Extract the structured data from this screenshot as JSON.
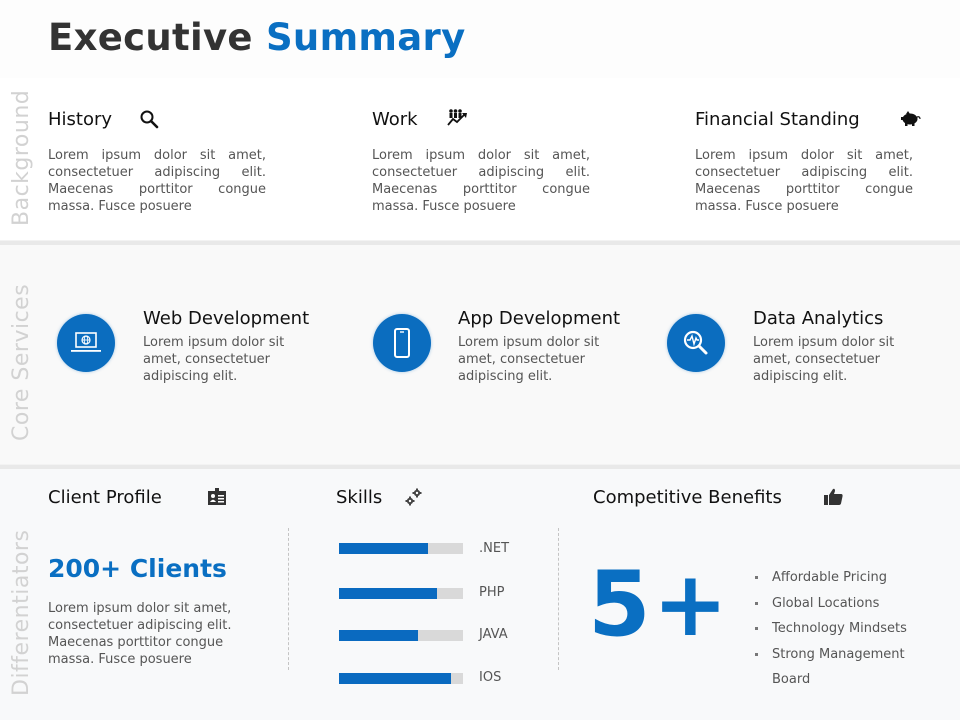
{
  "title": {
    "part1": "Executive",
    "part2": "Summary"
  },
  "colors": {
    "accent": "#0a6fc2",
    "title_dark": "#333333",
    "side_label": "#d2d2d2",
    "bar_track": "#d9d9d9"
  },
  "sections": {
    "background": {
      "label": "Background",
      "items": [
        {
          "title": "History",
          "icon": "magnifier-icon",
          "text": "Lorem ipsum dolor sit amet, consectetuer adipiscing elit. Maecenas porttitor congue massa. Fusce posuere"
        },
        {
          "title": "Work",
          "icon": "team-growth-icon",
          "text": "Lorem ipsum dolor sit amet, consectetuer adipiscing elit. Maecenas porttitor congue massa. Fusce posuere"
        },
        {
          "title": "Financial Standing",
          "icon": "piggy-bank-icon",
          "text": "Lorem ipsum dolor sit amet, consectetuer adipiscing elit. Maecenas porttitor congue massa. Fusce posuere"
        }
      ]
    },
    "core_services": {
      "label": "Core Services",
      "items": [
        {
          "title": "Web Development",
          "icon": "laptop-globe-icon",
          "text": "Lorem ipsum dolor sit amet, consectetuer adipiscing elit."
        },
        {
          "title": "App Development",
          "icon": "smartphone-icon",
          "text": "Lorem ipsum dolor sit amet, consectetuer adipiscing elit."
        },
        {
          "title": "Data Analytics",
          "icon": "analytics-magnifier-icon",
          "text": "Lorem ipsum dolor sit amet, consectetuer adipiscing elit."
        }
      ]
    },
    "differentiators": {
      "label": "Differentiators",
      "client_profile": {
        "title": "Client Profile",
        "icon": "id-card-icon",
        "headline": "200+ Clients",
        "text": "Lorem ipsum dolor sit amet, consectetuer adipiscing elit. Maecenas porttitor congue massa. Fusce posuere"
      },
      "skills": {
        "title": "Skills",
        "icon": "gears-icon",
        "items": [
          {
            "label": ".NET",
            "percent": 72
          },
          {
            "label": "PHP",
            "percent": 79
          },
          {
            "label": "JAVA",
            "percent": 64
          },
          {
            "label": "IOS",
            "percent": 90
          }
        ]
      },
      "competitive_benefits": {
        "title": "Competitive Benefits",
        "icon": "thumbs-up-icon",
        "big_number": "5+",
        "bullets": [
          "Affordable Pricing",
          "Global Locations",
          "Technology Mindsets",
          "Strong Management Board"
        ]
      }
    }
  }
}
